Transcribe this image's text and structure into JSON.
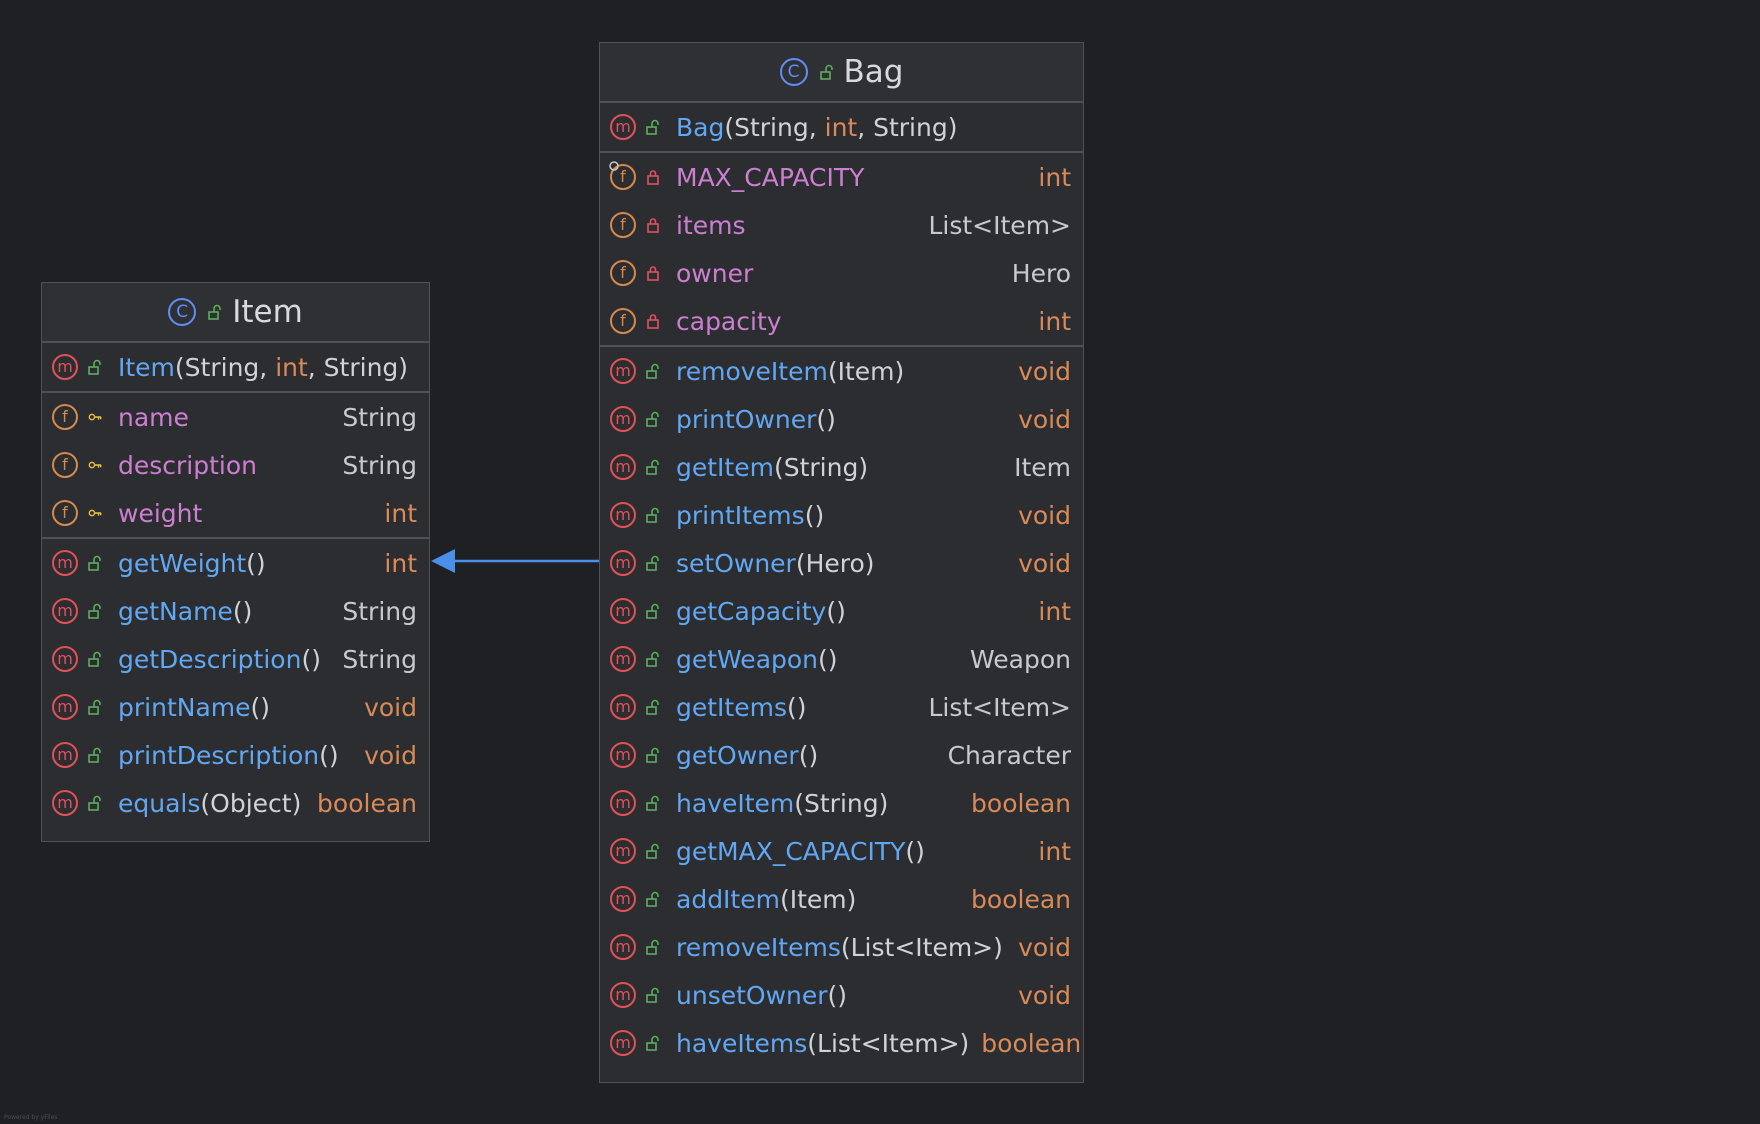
{
  "classes": {
    "bag": {
      "name": "Bag",
      "constructor": {
        "name": "Bag",
        "params": [
          {
            "text": "String",
            "prim": false
          },
          {
            "text": ", ",
            "prim": false
          },
          {
            "text": "int",
            "prim": true
          },
          {
            "text": ", String)",
            "prim": false
          }
        ]
      },
      "fields": [
        {
          "name": "MAX_CAPACITY",
          "type": "int",
          "type_kind": "prim",
          "static": true
        },
        {
          "name": "items",
          "type": "List<Item>",
          "type_kind": "obj"
        },
        {
          "name": "owner",
          "type": "Hero",
          "type_kind": "obj"
        },
        {
          "name": "capacity",
          "type": "int",
          "type_kind": "prim"
        }
      ],
      "methods": [
        {
          "name": "removeItem",
          "params": "(Item)",
          "ret": "void",
          "ret_kind": "prim"
        },
        {
          "name": "printOwner",
          "params": " ()",
          "ret": "void",
          "ret_kind": "prim"
        },
        {
          "name": "getItem",
          "params": "(String)",
          "ret": "Item",
          "ret_kind": "obj"
        },
        {
          "name": "printItems",
          "params": "()",
          "ret": "void",
          "ret_kind": "prim"
        },
        {
          "name": "setOwner",
          "params": " (Hero)",
          "ret": "void",
          "ret_kind": "prim"
        },
        {
          "name": "getCapacity",
          "params": "()",
          "ret": "int",
          "ret_kind": "prim"
        },
        {
          "name": "getWeapon",
          "params": "()",
          "ret": "Weapon",
          "ret_kind": "obj"
        },
        {
          "name": "getItems",
          "params": "()",
          "ret": "List<Item>",
          "ret_kind": "obj"
        },
        {
          "name": "getOwner",
          "params": " ()",
          "ret": "Character",
          "ret_kind": "obj"
        },
        {
          "name": "haveItem",
          "params": "(String)",
          "ret": "boolean",
          "ret_kind": "prim"
        },
        {
          "name": "getMAX_CAPACITY",
          "params": "()",
          "ret": "int",
          "ret_kind": "prim"
        },
        {
          "name": "addItem",
          "params": "(Item)",
          "ret": "boolean",
          "ret_kind": "prim"
        },
        {
          "name": "removeItems",
          "params": "(List<Item>)",
          "ret": "void",
          "ret_kind": "prim"
        },
        {
          "name": "unsetOwner",
          "params": " ()",
          "ret": "void",
          "ret_kind": "prim"
        },
        {
          "name": "haveItems",
          "params": "(List<Item>)",
          "ret": "boolean",
          "ret_kind": "prim"
        }
      ]
    },
    "item": {
      "name": "Item",
      "constructor": {
        "name": "Item",
        "params": [
          {
            "text": "(String, ",
            "prim": false
          },
          {
            "text": "int",
            "prim": true
          },
          {
            "text": ", String)",
            "prim": false
          }
        ]
      },
      "fields": [
        {
          "name": "name",
          "type": "String",
          "type_kind": "obj"
        },
        {
          "name": "description",
          "type": "String",
          "type_kind": "obj"
        },
        {
          "name": "weight",
          "type": "int",
          "type_kind": "prim"
        }
      ],
      "methods": [
        {
          "name": "getWeight",
          "params": " ()",
          "ret": "int",
          "ret_kind": "prim"
        },
        {
          "name": "getName",
          "params": "()",
          "ret": "String",
          "ret_kind": "obj"
        },
        {
          "name": "getDescription",
          "params": " ()",
          "ret": "String",
          "ret_kind": "obj"
        },
        {
          "name": "printName",
          "params": "()",
          "ret": "void",
          "ret_kind": "prim"
        },
        {
          "name": "printDescription",
          "params": " ()",
          "ret": "void",
          "ret_kind": "prim"
        },
        {
          "name": "equals",
          "params": "(Object)",
          "ret": "boolean",
          "ret_kind": "prim"
        }
      ]
    }
  },
  "badges": {
    "class": "C",
    "method": "m",
    "field": "f"
  },
  "icons": {
    "class": "class-icon",
    "method": "method-icon",
    "field": "field-icon",
    "public": "unlocked-icon",
    "private": "lock-icon",
    "package": "key-icon"
  },
  "colors": {
    "background": "#1f2024",
    "panel": "#2b2d30",
    "method_name": "#62a7f2",
    "field_name": "#cc7fd1",
    "primitive": "#d98a58",
    "arrow": "#4a8fe8"
  },
  "watermark": "Powered by yFiles"
}
